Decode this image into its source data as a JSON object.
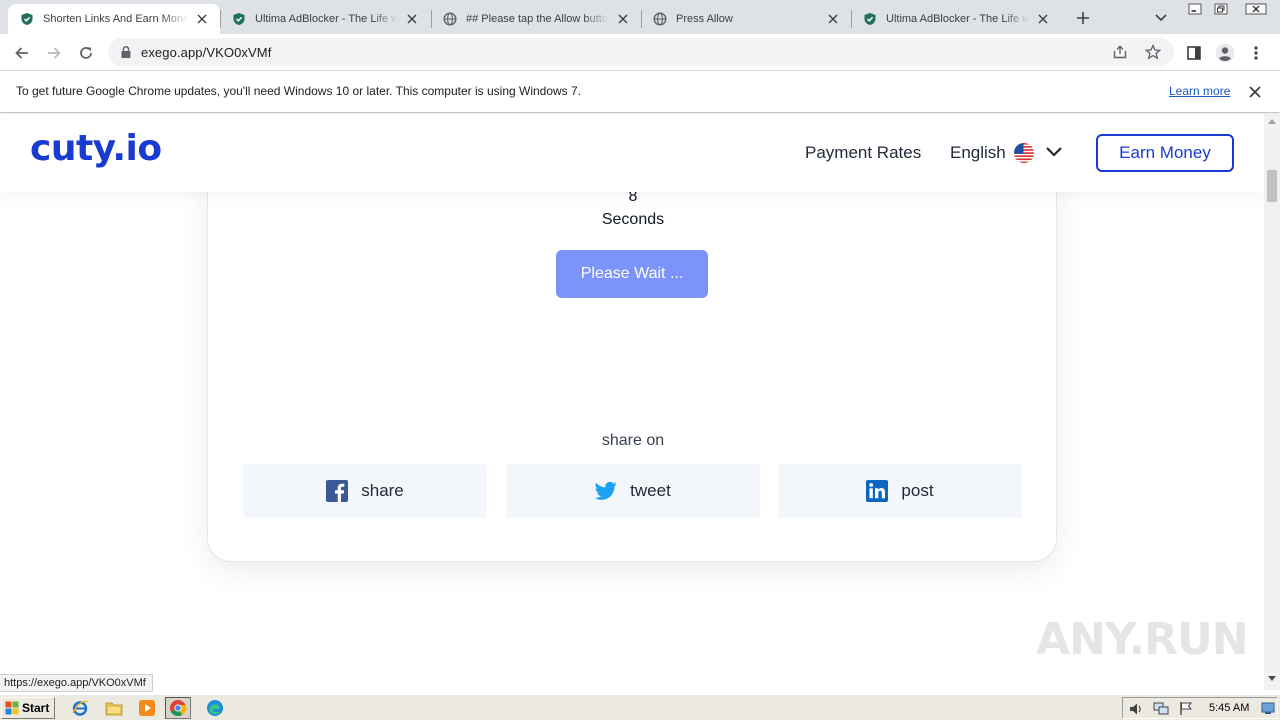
{
  "browser": {
    "tabs": [
      {
        "title": "Shorten Links And Earn Money",
        "favicon": "shield-check-icon",
        "active": true
      },
      {
        "title": "Ultima AdBlocker - The Life with",
        "favicon": "shield-check-icon",
        "active": false
      },
      {
        "title": "## Please tap the Allow button",
        "favicon": "globe-icon",
        "active": false
      },
      {
        "title": "Press Allow",
        "favicon": "globe-icon",
        "active": false
      },
      {
        "title": "Ultima AdBlocker - The Life with",
        "favicon": "shield-check-icon",
        "active": false
      }
    ],
    "url": "exego.app/VKO0xVMf",
    "infobar": {
      "message": "To get future Google Chrome updates, you'll need Windows 10 or later. This computer is using Windows 7.",
      "link": "Learn more"
    },
    "status_url": "https://exego.app/VKO0xVMf"
  },
  "site": {
    "logo": "cuty.io",
    "nav": {
      "payment_rates": "Payment Rates",
      "language": "English",
      "earn_money": "Earn Money"
    },
    "countdown": {
      "value": "8",
      "unit": "Seconds"
    },
    "wait_button": "Please Wait ...",
    "share": {
      "title": "share on",
      "buttons": [
        {
          "label": "share",
          "icon": "facebook-icon",
          "color": "#3b5998"
        },
        {
          "label": "tweet",
          "icon": "twitter-icon",
          "color": "#1da1f2"
        },
        {
          "label": "post",
          "icon": "linkedin-icon",
          "color": "#0a66c2"
        }
      ]
    },
    "colors": {
      "brand": "#1a3bd1",
      "wait_button": "#7b93fa"
    }
  },
  "watermark": "ANY.RUN",
  "taskbar": {
    "start": "Start",
    "clock": "5:45 AM"
  }
}
